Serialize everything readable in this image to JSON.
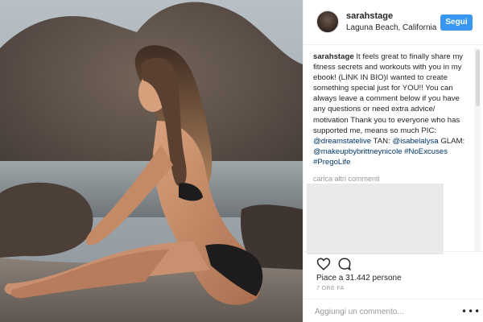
{
  "post": {
    "photo_alt": "Woman in black bikini sitting on sandy beach by rocks",
    "author": {
      "username": "sarahstage",
      "location": "Laguna Beach, California"
    },
    "follow_label": "Segui",
    "caption": {
      "username": "sarahstage",
      "text_1": " It feels great to finally share my fitness secrets and workouts with you in my ebook! ",
      "text_2": "(LINK IN BIO)I wanted to create something special just for YOU!! ",
      "text_3": " You can always leave a comment below if you have any questions or need extra advice/ motivation ",
      "text_4": " Thank you to everyone who has supported me, means so much ",
      "text_5": " PIC: ",
      "mention_1": "@dreamstatelive",
      "text_6": " TAN: ",
      "mention_2": "@isabelalysa",
      "text_7": " GLAM: ",
      "mention_3": "@makeupbybrittneynicole",
      "text_8": " ",
      "hashtag_1": "#NoExcuses",
      "text_9": " ",
      "hashtag_2": "#PregoLife"
    },
    "load_more_label": "carica altri commenti",
    "likes_text": "Piace a 31.442 persone",
    "timestamp": "7 ORE FA",
    "comment_placeholder": "Aggiungi un commento...",
    "more_glyph": "•••"
  },
  "icons": {
    "like": "heart-outline-icon",
    "comment": "speech-bubble-icon",
    "more": "more-options-icon"
  },
  "colors": {
    "accent": "#3897f0",
    "link": "#003569",
    "muted": "#999999",
    "text": "#262626"
  }
}
